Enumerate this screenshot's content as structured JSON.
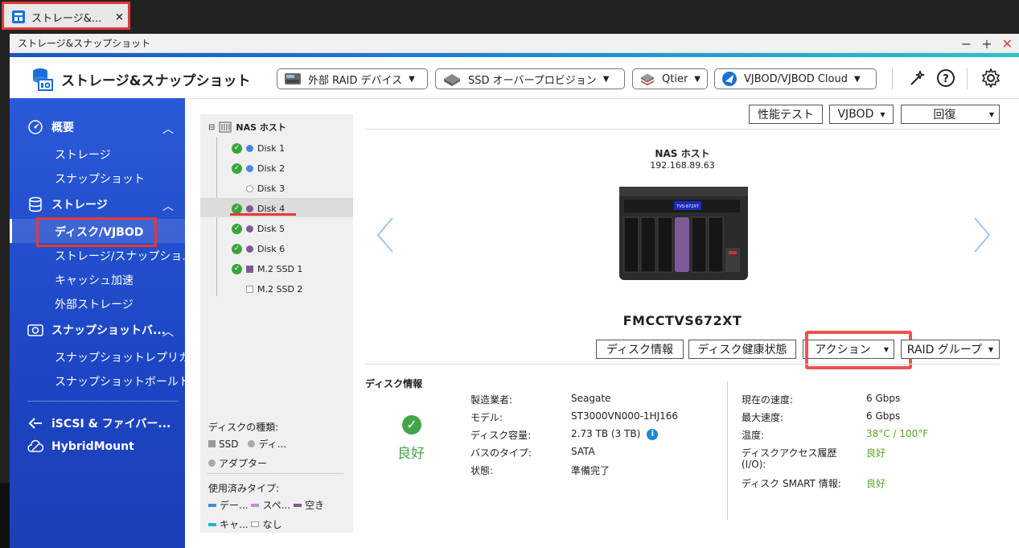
{
  "browser_tab": {
    "title": "ストレージ&...",
    "close": "×"
  },
  "window": {
    "title": "ストレージ&スナップショット",
    "minimize": "−",
    "maximize": "+",
    "close": "✕"
  },
  "header": {
    "app_title": "ストレージ&スナップショット",
    "buttons": [
      {
        "label": "外部 RAID デバイス"
      },
      {
        "label": "SSD オーバープロビジョン"
      },
      {
        "label": "Qtier"
      },
      {
        "label": "VJBOD/VJBOD Cloud"
      }
    ]
  },
  "sidebar": {
    "groups": [
      {
        "label": "概要",
        "items": [
          "ストレージ",
          "スナップショット"
        ]
      },
      {
        "label": "ストレージ",
        "items": [
          "ディスク/VJBOD",
          "ストレージ/スナップショ...",
          "キャッシュ加速",
          "外部ストレージ"
        ]
      },
      {
        "label": "スナップショットバ...",
        "items": [
          "スナップショットレプリカ",
          "スナップショットボールト"
        ]
      }
    ],
    "bottom": [
      "iSCSI & ファイバー...",
      "HybridMount"
    ],
    "active": "ディスク/VJBOD"
  },
  "tree": {
    "root": "NAS ホスト",
    "nodes": [
      {
        "label": "Disk 1",
        "ok": true,
        "color": "#4a86e8"
      },
      {
        "label": "Disk 2",
        "ok": true,
        "color": "#4a86e8"
      },
      {
        "label": "Disk 3",
        "ok": false,
        "color": "#ffffff"
      },
      {
        "label": "Disk 4",
        "ok": true,
        "color": "#7e5a9a"
      },
      {
        "label": "Disk 5",
        "ok": true,
        "color": "#7e5a9a"
      },
      {
        "label": "Disk 6",
        "ok": true,
        "color": "#7e5a9a"
      },
      {
        "label": "M.2 SSD 1",
        "ok": true,
        "color": "#7e5a9a"
      },
      {
        "label": "M.2 SSD 2",
        "ok": false,
        "color": "#ffffff"
      }
    ],
    "legend": {
      "disk_type_title": "ディスクの種類:",
      "ssd": "SSD",
      "di": "ディ...",
      "adapter": "アダプター",
      "used_type_title": "使用済みタイプ:",
      "data": "デー...",
      "spare": "スペ...",
      "free": "空き",
      "cache": "キャ...",
      "none": "なし"
    }
  },
  "main": {
    "top_buttons": {
      "perf": "性能テスト",
      "vjbod": "VJBOD",
      "recover": "回復"
    },
    "host_label": "NAS ホスト",
    "host_ip": "192.168.89.63",
    "model": "FMCCTVS672XT",
    "action_buttons": {
      "disk_info": "ディスク情報",
      "disk_health": "ディスク健康状態",
      "action": "アクション",
      "raid": "RAID グループ"
    },
    "section_title": "ディスク情報",
    "status": "良好",
    "left_info": [
      {
        "label": "製造業者:",
        "value": "Seagate"
      },
      {
        "label": "モデル:",
        "value": "ST3000VN000-1HJ166"
      },
      {
        "label": "ディスク容量:",
        "value": "2.73 TB (3 TB)"
      },
      {
        "label": "バスのタイプ:",
        "value": "SATA"
      },
      {
        "label": "状態:",
        "value": "準備完了"
      }
    ],
    "right_info": [
      {
        "label": "現在の速度:",
        "value": "6 Gbps"
      },
      {
        "label": "最大速度:",
        "value": "6 Gbps"
      },
      {
        "label": "温度:",
        "value": "38°C / 100°F"
      },
      {
        "label": "ディスクアクセス履歴",
        "label2": "(I/O):",
        "value": "良好"
      },
      {
        "label": "ディスク SMART 情報:",
        "value": "良好"
      }
    ]
  }
}
